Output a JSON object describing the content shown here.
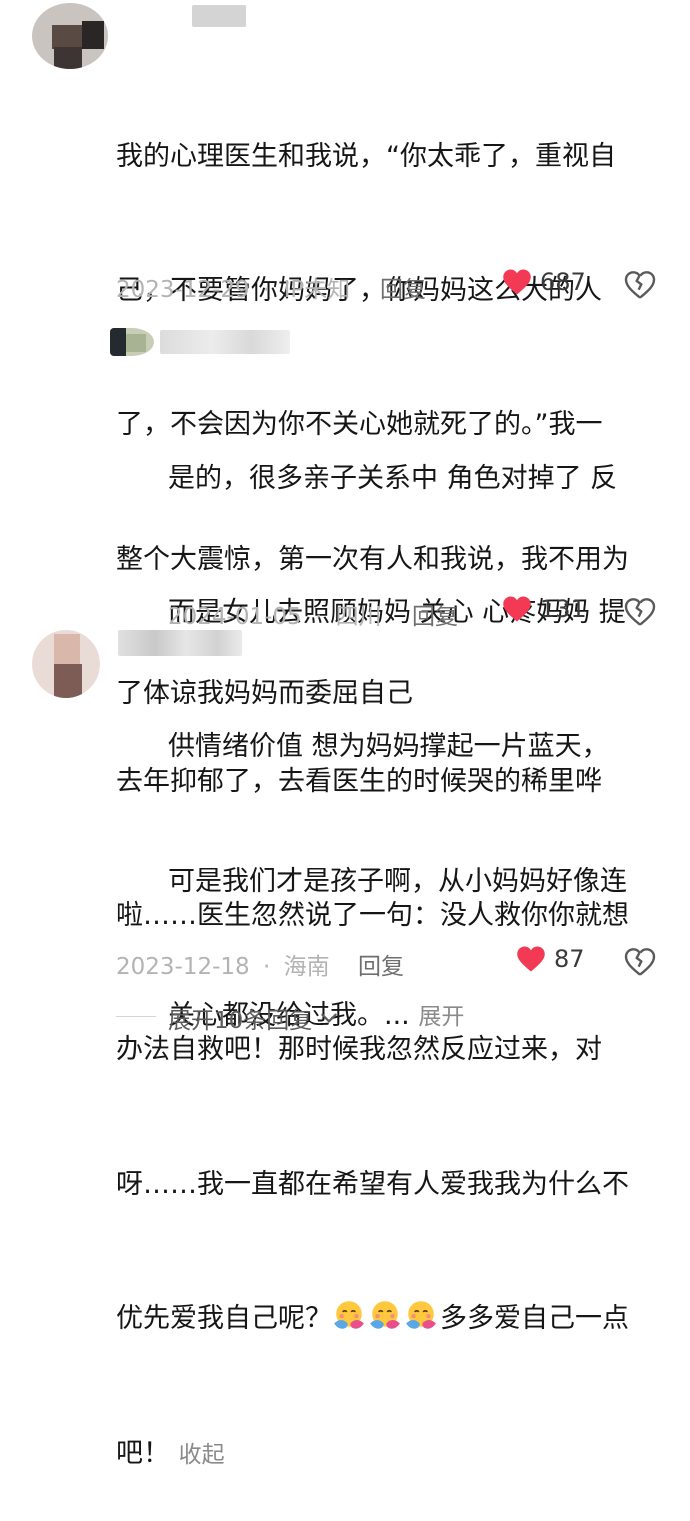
{
  "comments": [
    {
      "lines": [
        "我的心理医生和我说，“你太乖了，重视自",
        "己，不要管你妈妈了，你妈妈这么大的人",
        "了，不会因为你不关心她就死了的。”我一",
        "整个大震惊，第一次有人和我说，我不用为",
        "了体谅我妈妈而委屈自己"
      ],
      "date": "2023-12-29",
      "location": "IP未知",
      "reply_label": "回复",
      "likes": "687"
    },
    {
      "lines": [
        "是的，很多亲子关系中 角色对掉了 反",
        "而是女儿去照顾妈妈 关心 心疼妈妈 提",
        "供情绪价值 想为妈妈撑起一片蓝天，",
        "可是我们才是孩子啊，从小妈妈好像连",
        "关心都没给过我。..."
      ],
      "expand_label": "展开",
      "date": "2024-01-05",
      "location": "四川",
      "reply_label": "回复",
      "likes": "131"
    },
    {
      "lines": [
        "去年抑郁了，去看医生的时候哭的稀里哗",
        "啦……医生忽然说了一句：没人救你你就想",
        "办法自救吧！那时候我忽然反应过来，对",
        "呀……我一直都在希望有人爱我我为什么不"
      ],
      "line5_prefix": "优先爱我自己呢？",
      "line5_suffix": "多多爱自己一点",
      "last_line": "吧！",
      "collapse_label": "收起",
      "emoji": "hugging-face-emoji",
      "date": "2023-12-18",
      "location": "海南",
      "reply_label": "回复",
      "likes": "87"
    }
  ],
  "meta_separator": "·",
  "expand_replies_label": "展开10条回复",
  "colors": {
    "like_red": "#f23a55",
    "meta_gray": "#b3b3b3",
    "text": "#161616"
  }
}
